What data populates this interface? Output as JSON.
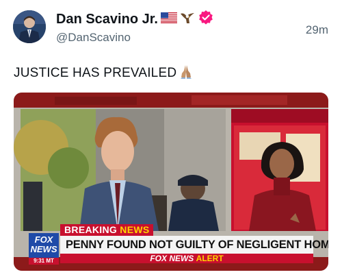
{
  "author": {
    "name": "Dan Scavino Jr.",
    "name_emojis": [
      "us-flag-icon",
      "eagle-icon"
    ],
    "verified_color": "#f91880",
    "handle": "@DanScavino",
    "timestamp": "29m"
  },
  "tweet": {
    "text": "JUSTICE HAS PREVAILED",
    "emoji": "folded-hands-icon"
  },
  "media": {
    "breaking_label": "BREAKING",
    "breaking_news": "NEWS",
    "headline": "PENNY FOUND NOT GUILTY OF NEGLIGENT HOMICIDE",
    "network_logo_line1": "FOX",
    "network_logo_line2": "NEWS",
    "clock": "9:31 MT",
    "alert_prefix": "FOX NEWS",
    "alert_word": "ALERT",
    "colors": {
      "red": "#c8102e",
      "blue": "#1f4aa8",
      "yellow": "#ffd400"
    }
  }
}
